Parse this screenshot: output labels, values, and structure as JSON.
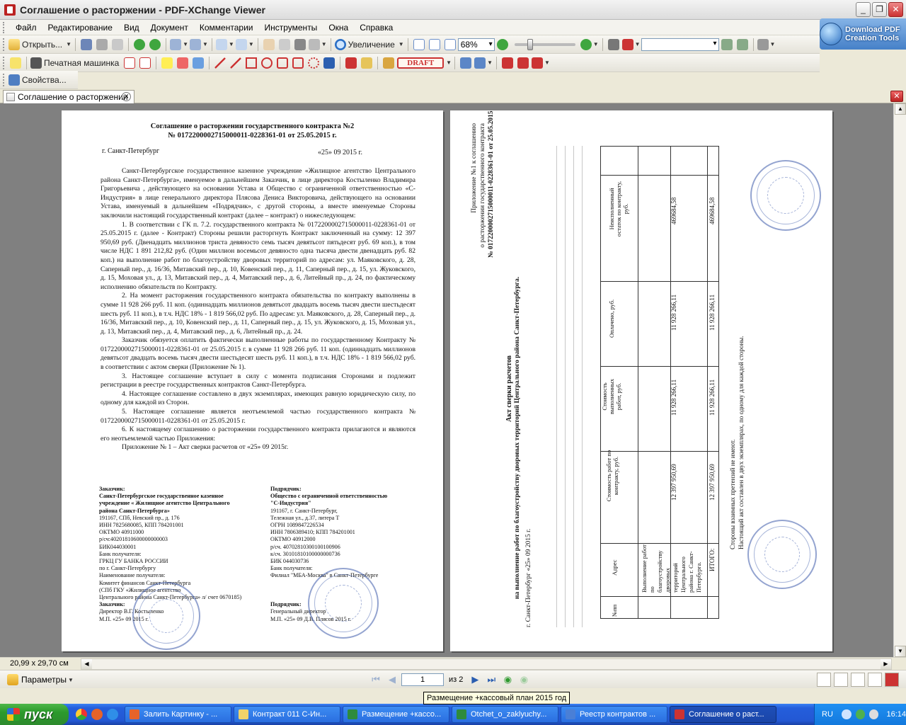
{
  "window": {
    "title": "Соглашение о расторжении - PDF-XChange Viewer"
  },
  "menu": [
    "Файл",
    "Редактирование",
    "Вид",
    "Документ",
    "Комментарии",
    "Инструменты",
    "Окна",
    "Справка"
  ],
  "toolbar1": {
    "open_label": "Открыть...",
    "zoom_label": "Увеличение",
    "zoom_value": "68%"
  },
  "toolbar2": {
    "typewriter_label": "Печатная машинка",
    "draft_label": "DRAFT"
  },
  "toolbar3": {
    "properties_label": "Свойства..."
  },
  "promo": {
    "line1": "Download PDF",
    "line2": "Creation Tools"
  },
  "tab": {
    "label": "Соглашение о расторжении"
  },
  "page1": {
    "title1": "Соглашение о расторжении государственного контракта №2",
    "title2": "№ 0172200002715000011-0228361-01 от 25.05.2015 г.",
    "city": "г. Санкт-Петербург",
    "date": "«25» 09 2015 г.",
    "para_intro": "Санкт-Петербургское государственное казенное учреждение «Жилищное агентство Центрального района Санкт-Петербурга», именуемое в дальнейшем Заказчик, в лице директора Костыленко Владимира Григорьевича , действующего на основании Устава и Общество с ограниченной ответственностью «С-Индустрия» в лице генерального директора Плясова Дениса Викторовича, действующего на основании Устава, именуемый в дальнейшем «Подрядчик», с другой стороны, а вместе именуемые Стороны заключили настоящий государственный контракт (далее – контракт) о нижеследующем:",
    "para1": "1. В соответствии с ГК п. 7.2. государственного контракта № 0172200002715000011-0228361-01 от 25.05.2015 г. (далее - Контракт) Стороны решили расторгнуть Контракт заключенный на сумму: 12 397 950,69 руб. (Двенадцать миллионов триста девяносто семь тысяч девятьсот пятьдесят руб. 69 коп.), в том числе НДС 1 891 212,82 руб. (Один миллион восемьсот девяносто одна тысяча двести двенадцать руб. 82 коп.) на выполнение работ по благоустройству дворовых территорий по адресам: ул. Маяковского, д. 28, Саперный пер., д. 16/36, Митавский пер., д. 10, Ковенский пер., д. 11, Саперный пер., д. 15, ул. Жуковского, д. 15, Моховая ул., д. 13, Митавский пер., д. 4, Митавский пер., д. 6, Литейный пр., д. 24, по фактическому исполнению обязательств по Контракту.",
    "para2": "2. На момент расторжения государственного контракта обязательства по контракту выполнены в сумме 11 928 266 руб. 11 коп. (одиннадцать миллионов девятьсот двадцать восемь тысяч двести шестьдесят шесть руб. 11 коп.), в т.ч. НДС 18% - 1 819 566,02 руб. По адресам: ул. Маяковского, д. 28, Саперный пер., д. 16/36, Митавский пер., д. 10, Ковенский пер., д. 11, Саперный пер., д. 15, ул. Жуковского, д. 15, Моховая ул., д. 13, Митавский пер., д. 4, Митавский пер., д. 6, Литейный пр., д. 24.",
    "para2b": "Заказчик обязуется оплатить фактически выполненные работы по государственному Контракту № 0172200002715000011-0228361-01 от 25.05.2015 г. в сумме 11 928 266 руб. 11 коп. (одиннадцать миллионов девятьсот двадцать восемь тысяч двести шестьдесят шесть руб. 11 коп.), в т.ч. НДС 18% - 1 819 566,02 руб. в соответствии с актом сверки (Приложение № 1).",
    "para3": "3. Настоящее соглашение вступает в силу с момента подписания Сторонами и подлежит регистрации в реестре государственных контрактов Санкт-Петербурга.",
    "para4": "4. Настоящее соглашение составлено в двух экземплярах, имеющих равную юридическую силу, по одному для каждой из Сторон.",
    "para5": "5. Настоящее соглашение является неотъемлемой частью государственного контракта № 0172200002715000011-0228361-01 от 25.05.2015 г.",
    "para6": "6. К настоящему соглашению о расторжении государственного контракта прилагаются и являются его неотъемлемой частью Приложения:",
    "appendix": "Приложение № 1 – Акт сверки расчетов от «25» 09 2015г.",
    "customer": [
      "Заказчик:",
      "Санкт-Петербургское государственное казенное",
      "учреждение « Жилищное агентство Центрального",
      "района Санкт-Петербурга»",
      "191167, СПб, Невский пр., д. 176",
      "ИНН 7825680085, КПП 784201001",
      "ОКТМО 40911000",
      "р/сч:40201810600000000003",
      "БИК044030001",
      "Банк получателя:",
      "ГРКЦ ГУ БАНКА РОССИИ",
      "по г. Санкт-Петербургу",
      "Наименование получателя:",
      "Комитет финансов Санкт-Петербурга",
      "(СПб ГКУ «Жилищное агентство",
      "Центрального района Санкт-Петербурга» л/ счет 0670185)",
      "Заказчик:",
      "Директор                                В.Г. Костыленко",
      "М.П. «25» 09           2015 г."
    ],
    "contractor": [
      "Подрядчик:",
      "Общество с ограниченной ответственностью",
      "\"С-Индустрия\"",
      "191167, г. Санкт-Петербург,",
      "Тележная ул., д.37, литера Т",
      "ОГРН 1089847226534",
      "ИНН 7806389410; КПП 784201001",
      "ОКТМО 40912000",
      "р/сч. 40702810300100100906",
      "к/сч. 30101810100000000736",
      "БИК 044030736",
      "Банк получателя:",
      "Филиал \"МБА-Москва\" в Санкт-Петербурге",
      "",
      "",
      "",
      "Подрядчик:",
      "Генеральный директор",
      "М.П. «25» 09           Д.В. Плясов 2015 г."
    ]
  },
  "page2": {
    "appendix_header": [
      "Приложение №1 к соглашению",
      "о расторжении государственного контракта",
      "№ 0172200002715000011-0228361-01 от 25.05.2015 г."
    ],
    "act_title": "Акт сверки расчетов",
    "act_subtitle": "на выполнение работ по благоустройству дворовых территорий Центрального района Санкт-Петербурга.",
    "city_date": "г. Санкт-Петербург «25» 09 2015 г.",
    "columns": [
      "№пп",
      "Адрес",
      "Стоимость работ по контракту, руб.",
      "Стоимость выполненных работ, руб.",
      "Оплачено, руб.",
      "Неисполненный остаток по контракту, руб."
    ],
    "row_address": "Выполнение работ по благоустройству дворовых территорий Центрального района г. Санкт-Петербурга.",
    "row_values": [
      "12 397 950,69",
      "11 928 266,11",
      "11 928 266,11",
      "469684,58"
    ],
    "total_label": "ИТОГО:",
    "total_values": [
      "12 397 950,69",
      "11 928 266,11",
      "11 928 266,11",
      "469684,58"
    ],
    "no_claims": "Стороны взаимных претензий не имеют.",
    "copies": "Настоящий акт составлен в двух экземплярах, по одному для каждой стороны."
  },
  "status": {
    "page_size": "20,99 x 29,70 см"
  },
  "navbar": {
    "params_label": "Параметры",
    "current_page": "1",
    "of_pages": "из 2"
  },
  "tooltip": "Размещение +кассовый план 2015 год",
  "taskbar": {
    "start_label": "пуск",
    "tasks": [
      "Залить Картинку - ...",
      "Контракт 011 С-Ин...",
      "Размещение +кассо...",
      "Otchet_o_zaklyuchy...",
      "Реестр контрактов ...",
      "Соглашение о раст..."
    ],
    "lang": "RU",
    "clock": "16:14"
  },
  "colors": {
    "desktop_bg": "#ECE9D8",
    "doc_bg": "#808080",
    "taskbar": "#245EDB",
    "start": "#2C9A2C"
  }
}
